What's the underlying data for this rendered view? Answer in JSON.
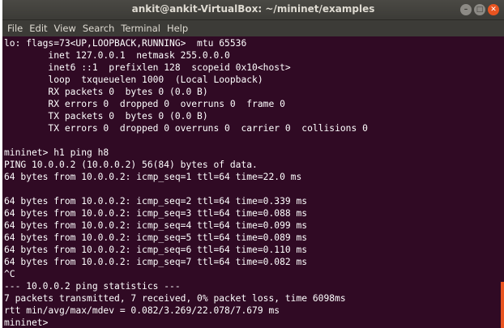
{
  "window": {
    "title": "ankit@ankit-VirtualBox: ~/mininet/examples",
    "controls": {
      "minimize_glyph": "–",
      "maximize_glyph": "□",
      "close_glyph": "✕"
    }
  },
  "menu": [
    "File",
    "Edit",
    "View",
    "Search",
    "Terminal",
    "Help"
  ],
  "terminal": {
    "lines": [
      "lo: flags=73<UP,LOOPBACK,RUNNING>  mtu 65536",
      "        inet 127.0.0.1  netmask 255.0.0.0",
      "        inet6 ::1  prefixlen 128  scopeid 0x10<host>",
      "        loop  txqueuelen 1000  (Local Loopback)",
      "        RX packets 0  bytes 0 (0.0 B)",
      "        RX errors 0  dropped 0  overruns 0  frame 0",
      "        TX packets 0  bytes 0 (0.0 B)",
      "        TX errors 0  dropped 0 overruns 0  carrier 0  collisions 0",
      "",
      "mininet> h1 ping h8",
      "PING 10.0.0.2 (10.0.0.2) 56(84) bytes of data.",
      "64 bytes from 10.0.0.2: icmp_seq=1 ttl=64 time=22.0 ms",
      "",
      "64 bytes from 10.0.0.2: icmp_seq=2 ttl=64 time=0.339 ms",
      "64 bytes from 10.0.0.2: icmp_seq=3 ttl=64 time=0.088 ms",
      "64 bytes from 10.0.0.2: icmp_seq=4 ttl=64 time=0.099 ms",
      "64 bytes from 10.0.0.2: icmp_seq=5 ttl=64 time=0.089 ms",
      "64 bytes from 10.0.0.2: icmp_seq=6 ttl=64 time=0.110 ms",
      "64 bytes from 10.0.0.2: icmp_seq=7 ttl=64 time=0.082 ms",
      "^C",
      "--- 10.0.0.2 ping statistics ---",
      "7 packets transmitted, 7 received, 0% packet loss, time 6098ms",
      "rtt min/avg/max/mdev = 0.082/3.269/22.078/7.679 ms",
      "mininet>"
    ]
  },
  "colors": {
    "terminal_bg": "#300a24",
    "titlebar_bg": "#3c3b37",
    "accent": "#e95420",
    "text": "#ffffff"
  },
  "scrollbar": {
    "position_fraction": 0.86
  }
}
